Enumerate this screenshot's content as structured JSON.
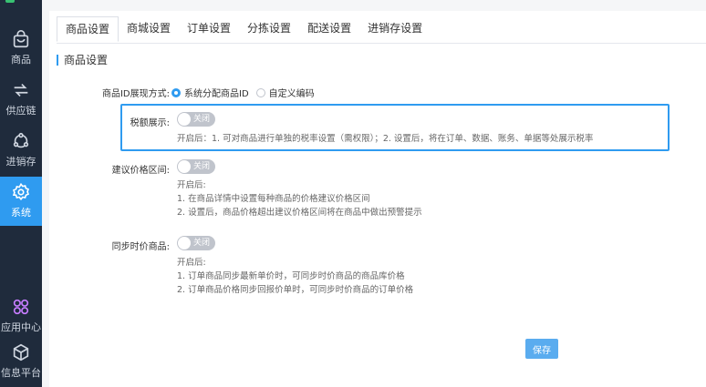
{
  "sidebar": {
    "items": [
      {
        "label": "商品",
        "icon": "bag-icon"
      },
      {
        "label": "供应链",
        "icon": "exchange-arrows-icon"
      },
      {
        "label": "进销存",
        "icon": "cycle-nodes-icon"
      },
      {
        "label": "系统",
        "icon": "gear-icon"
      },
      {
        "label": "应用中心",
        "icon": "apps-icon"
      },
      {
        "label": "信息平台",
        "icon": "cube-icon"
      }
    ]
  },
  "tabs": [
    "商品设置",
    "商城设置",
    "订单设置",
    "分拣设置",
    "配送设置",
    "进销存设置"
  ],
  "active_tab": "商品设置",
  "section_title": "商品设置",
  "product_id": {
    "label": "商品ID展现方式:",
    "options": [
      "系统分配商品ID",
      "自定义编码"
    ],
    "selected": "系统分配商品ID"
  },
  "tax_display": {
    "label": "税额展示:",
    "toggle_text": "关闭",
    "hint": "开启后：1. 可对商品进行单独的税率设置（需权限）；2. 设置后，将在订单、数据、账务、单据等处展示税率"
  },
  "price_range": {
    "label": "建议价格区间:",
    "toggle_text": "关闭",
    "hint_title": "开启后:",
    "hint_1": "1. 在商品详情中设置每种商品的价格建议价格区间",
    "hint_2": "2. 设置后，商品价格超出建议价格区间将在商品中做出预警提示"
  },
  "sync_price": {
    "label": "同步时价商品:",
    "toggle_text": "关闭",
    "hint_title": "开启后:",
    "hint_1": "1. 订单商品同步最新单价时，可同步时价商品的商品库价格",
    "hint_2": "2. 订单商品价格同步回报价单时，可同步时价商品的订单价格"
  },
  "save_label": "保存",
  "colors": {
    "sidebar_bg": "#1f2b3c",
    "accent": "#2f9bf0",
    "save_button": "#5aacef",
    "toggle_off": "#c0c4cc"
  }
}
